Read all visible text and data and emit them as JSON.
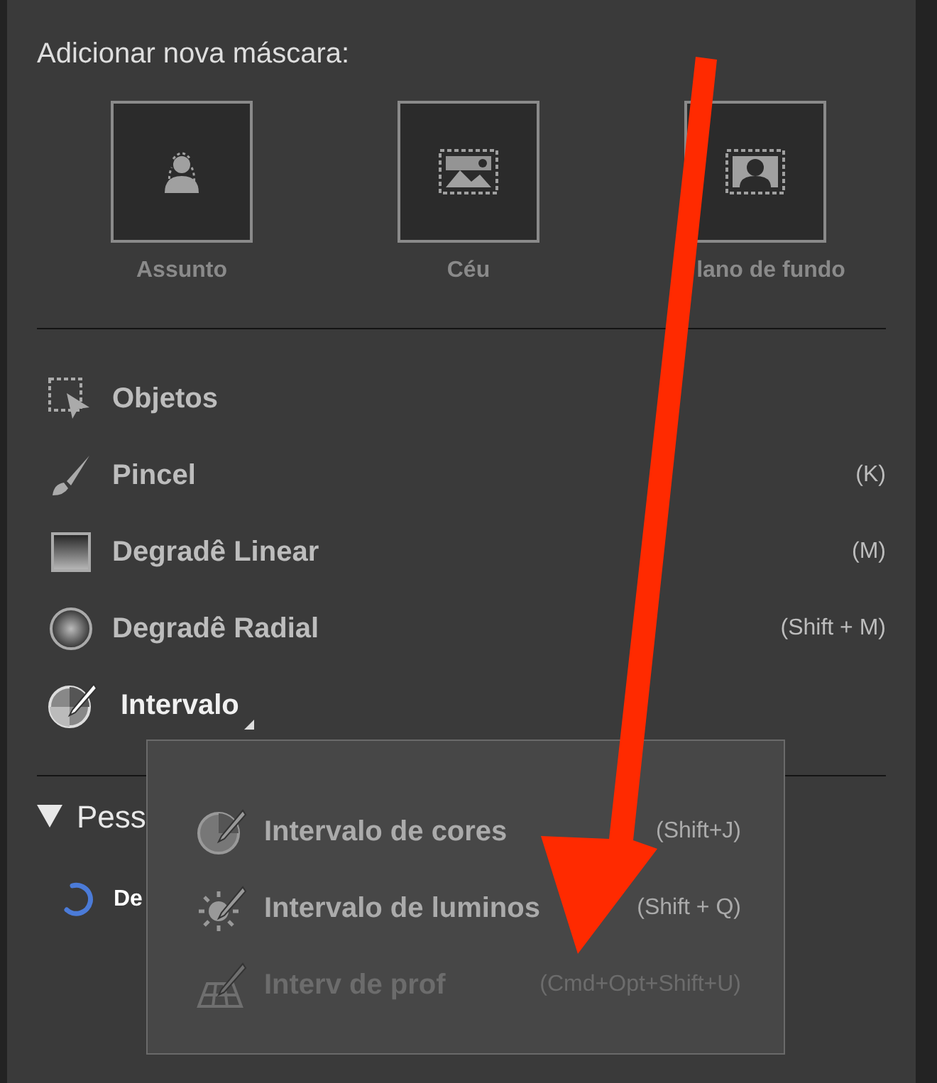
{
  "heading": "Adicionar nova máscara:",
  "mask_buttons": [
    {
      "label": "Assunto"
    },
    {
      "label": "Céu"
    },
    {
      "label": "lano de fundo"
    }
  ],
  "tools": [
    {
      "label": "Objetos",
      "selected": false
    },
    {
      "label": "Pincel",
      "shortcut": "(K)",
      "selected": false
    },
    {
      "label": "Degradê Linear",
      "shortcut": "(M)",
      "selected": false
    },
    {
      "label": "Degradê Radial",
      "shortcut": "(Shift + M)",
      "selected": false
    },
    {
      "label": "Intervalo",
      "selected": true
    }
  ],
  "section": {
    "title": "Pess",
    "expanded": true,
    "row": "De"
  },
  "menu": [
    {
      "label": "Intervalo de cores",
      "shortcut": "(Shift+J)",
      "disabled": false
    },
    {
      "label": "Intervalo de luminos",
      "shortcut": "(Shift + Q)",
      "disabled": false
    },
    {
      "label": "Interv de prof",
      "shortcut": "(Cmd+Opt+Shift+U)",
      "disabled": true
    }
  ]
}
